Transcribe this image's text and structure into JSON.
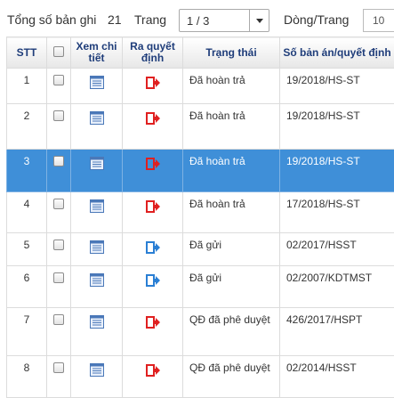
{
  "toolbar": {
    "total_label": "Tổng số bản ghi",
    "total_value": "21",
    "page_label": "Trang",
    "page_value": "1 / 3",
    "rows_label": "Dòng/Trang",
    "rows_value": "10"
  },
  "table": {
    "headers": {
      "stt": "STT",
      "detail": "Xem chi tiết",
      "decision": "Ra quyết định",
      "status": "Trạng thái",
      "docno": "Số bản án/quyết định"
    },
    "rows": [
      {
        "stt": "1",
        "status": "Đã hoàn trả",
        "docno": "19/2018/HS-ST",
        "icon": "exit-red-icon",
        "selected": false
      },
      {
        "stt": "2",
        "status": "Đã hoàn trả",
        "docno": "19/2018/HS-ST",
        "icon": "exit-red-icon",
        "selected": false
      },
      {
        "stt": "3",
        "status": "Đã hoàn trả",
        "docno": "19/2018/HS-ST",
        "icon": "exit-red-icon",
        "selected": true
      },
      {
        "stt": "4",
        "status": "Đã hoàn trả",
        "docno": "17/2018/HS-ST",
        "icon": "exit-red-icon",
        "selected": false
      },
      {
        "stt": "5",
        "status": "Đã gửi",
        "docno": "02/2017/HSST",
        "icon": "exit-blue-icon",
        "selected": false
      },
      {
        "stt": "6",
        "status": "Đã gửi",
        "docno": "02/2007/KDTMST",
        "icon": "exit-blue-icon",
        "selected": false
      },
      {
        "stt": "7",
        "status": "QĐ đã phê duyệt",
        "docno": "426/2017/HSPT",
        "icon": "exit-red-icon",
        "selected": false
      },
      {
        "stt": "8",
        "status": "QĐ đã phê duyệt",
        "docno": "02/2014/HSST",
        "icon": "exit-red-icon",
        "selected": false
      }
    ]
  },
  "colors": {
    "selected_row": "#3f8fd8",
    "header_text": "#1f3d7a",
    "exit_red": "#e02020",
    "exit_blue": "#2a7fd4"
  }
}
